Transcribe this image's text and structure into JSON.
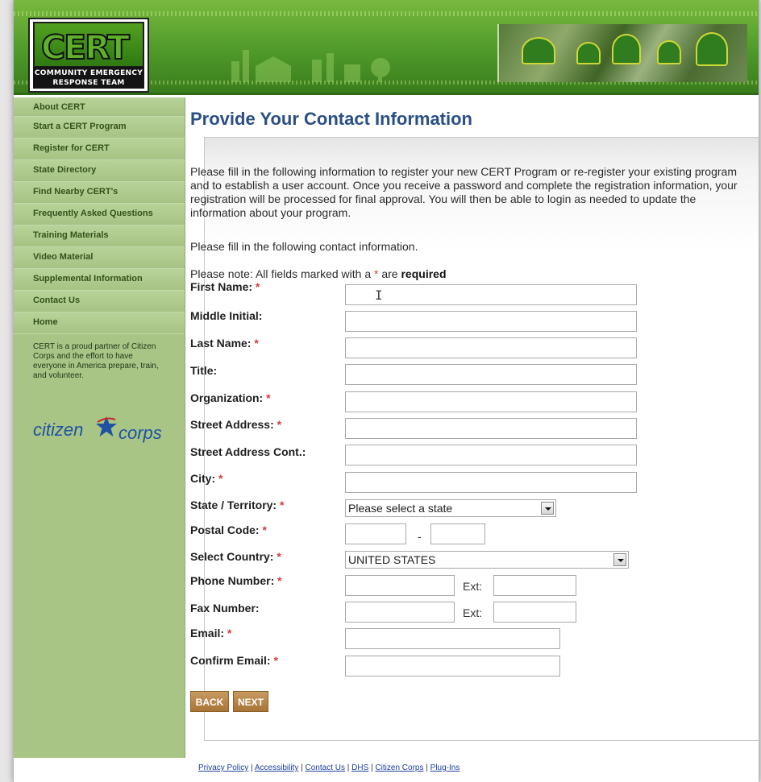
{
  "header": {
    "logo_word": "CERT",
    "logo_sub_line1": "COMMUNITY EMERGENCY",
    "logo_sub_line2": "RESPONSE TEAM"
  },
  "sidebar": {
    "items": [
      {
        "label": "About CERT"
      },
      {
        "label": "Start a CERT Program"
      },
      {
        "label": "Register for CERT"
      },
      {
        "label": "State Directory"
      },
      {
        "label": "Find Nearby CERT's"
      },
      {
        "label": "Frequently Asked Questions"
      },
      {
        "label": "Training Materials"
      },
      {
        "label": "Video Material"
      },
      {
        "label": "Supplemental Information"
      },
      {
        "label": "Contact Us"
      },
      {
        "label": "Home"
      }
    ],
    "partner_text": "CERT is a proud partner of Citizen Corps and the effort to have everyone in America prepare, train, and volunteer.",
    "cc_logo_left": "citizen",
    "cc_logo_right": "corps"
  },
  "main": {
    "title": "Provide Your Contact Information",
    "intro": "Please fill in the following information to register your new CERT Program or re-register your existing program and to establish a user account. Once you receive a password and complete the registration information, your registration will be processed for final approval. You will then be able to login as needed to update the information about your program.",
    "intro2": "Please fill in the following contact information.",
    "note_prefix": "Please note: All fields marked with a",
    "note_star": "*",
    "note_mid": "are",
    "note_bold": "required",
    "required_marker": "*"
  },
  "form": {
    "first_name": "First Name:",
    "middle_initial": "Middle Initial:",
    "last_name": "Last Name:",
    "title": "Title:",
    "organization": "Organization:",
    "street_address": "Street Address:",
    "street_address_cont": "Street Address Cont.:",
    "city": "City:",
    "state": "State / Territory:",
    "state_value": "Please select a state",
    "postal_code": "Postal Code:",
    "postal_dash": "-",
    "country": "Select Country:",
    "country_value": "UNITED STATES",
    "phone": "Phone Number:",
    "fax": "Fax Number:",
    "ext": "Ext:",
    "email": "Email:",
    "confirm_email": "Confirm Email:",
    "back_label": "BACK",
    "next_label": "NEXT"
  },
  "footer": {
    "links": [
      "Privacy Policy",
      "Accessibility",
      "Contact Us",
      "DHS",
      "Citizen Corps",
      "Plug-Ins"
    ],
    "separator": "|"
  },
  "colors": {
    "header_green": "#4f9a2a",
    "sidebar_green": "#a8c585",
    "title_blue": "#2a4f83",
    "required_red": "#d63a3a",
    "button_brown": "#b07d40"
  }
}
